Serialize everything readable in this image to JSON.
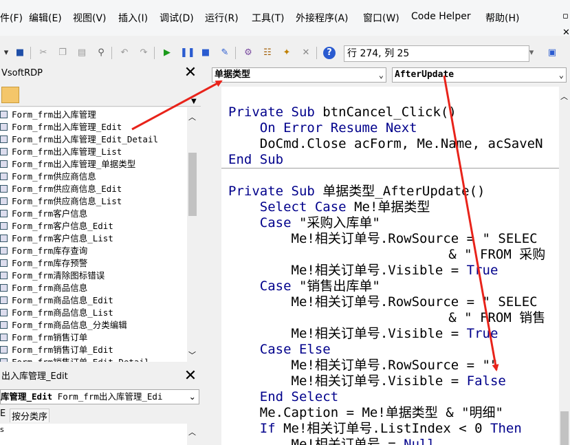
{
  "menu": [
    "件(F)",
    "编辑(E)",
    "视图(V)",
    "插入(I)",
    "调试(D)",
    "运行(R)",
    "工具(T)",
    "外接程序(A)",
    "窗口(W)",
    "Code Helper",
    "帮助(H)"
  ],
  "toolbar": {
    "position": "行 274, 列 25"
  },
  "project_pane": {
    "title": "VsoftRDP",
    "items": [
      "Form_frm出入库管理",
      "Form_frm出入库管理_Edit",
      "Form_frm出入库管理_Edit_Detail",
      "Form_frm出入库管理_List",
      "Form_frm出入库管理_单据类型",
      "Form_frm供应商信息",
      "Form_frm供应商信息_Edit",
      "Form_frm供应商信息_List",
      "Form_frm客户信息",
      "Form_frm客户信息_Edit",
      "Form_frm客户信息_List",
      "Form_frm库存查询",
      "Form_frm库存预警",
      "Form_frm清除图标错误",
      "Form_frm商品信息",
      "Form_frm商品信息_Edit",
      "Form_frm商品信息_List",
      "Form_frm商品信息_分类编辑",
      "Form_frm销售订单",
      "Form_frm销售订单_Edit",
      "Form_frm销售订单_Edit_Detail"
    ]
  },
  "properties_pane": {
    "title": "出入库管理_Edit",
    "object_bold": "库管理_Edit",
    "object_rest": "Form_frm出入库管理_Edi",
    "tab_left": "E",
    "tab_category": "按分类序",
    "first_row": "s"
  },
  "code_window": {
    "object_combo": "单据类型",
    "procedure_combo": "AfterUpdate",
    "lines": [
      "Private Sub btnCancel_Click()",
      "    On Error Resume Next",
      "    DoCmd.Close acForm, Me.Name, acSaveN",
      "End Sub",
      "Private Sub 单据类型_AfterUpdate()",
      "    Select Case Me!单据类型",
      "    Case \"采购入库单\"",
      "        Me!相关订单号.RowSource = \" SELEC",
      "                            & \" FROM 采购",
      "        Me!相关订单号.Visible = True",
      "    Case \"销售出库单\"",
      "        Me!相关订单号.RowSource = \" SELEC",
      "                            & \" FROM 销售",
      "        Me!相关订单号.Visible = True",
      "    Case Else",
      "        Me!相关订单号.RowSource = \"\"",
      "        Me!相关订单号.Visible = False",
      "    End Select",
      "    Me.Caption = Me!单据类型 & \"明细\"",
      "    If Me!相关订单号.ListIndex < 0 Then",
      "        Me!相关订单号 = Null"
    ]
  },
  "colors": {
    "keyword": "#00008b",
    "arrow": "#e8231a"
  }
}
